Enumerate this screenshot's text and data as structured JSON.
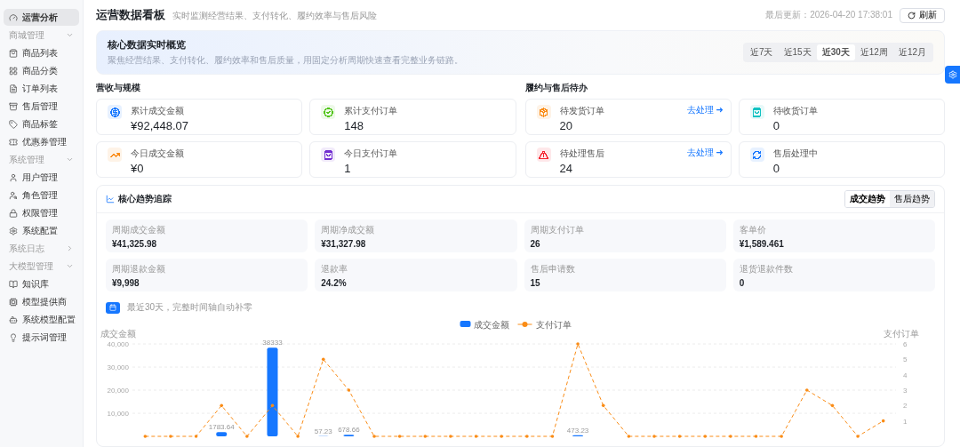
{
  "sidebar": {
    "items": [
      {
        "kind": "link",
        "label": "运营分析",
        "selected": true
      },
      {
        "kind": "group",
        "label": "商城管理",
        "expanded": true,
        "children": [
          {
            "label": "商品列表",
            "selected": false
          },
          {
            "label": "商品分类",
            "selected": false
          },
          {
            "label": "订单列表",
            "selected": false
          },
          {
            "label": "售后管理",
            "selected": false
          },
          {
            "label": "商品标签",
            "selected": false
          },
          {
            "label": "优惠券管理",
            "selected": false
          }
        ]
      },
      {
        "kind": "group",
        "label": "系统管理",
        "expanded": true,
        "children": [
          {
            "label": "用户管理",
            "selected": false
          },
          {
            "label": "角色管理",
            "selected": false
          },
          {
            "label": "权限管理",
            "selected": false
          },
          {
            "label": "系统配置",
            "selected": false
          }
        ]
      },
      {
        "kind": "group",
        "label": "系统日志",
        "expanded": false
      },
      {
        "kind": "group",
        "label": "大模型管理",
        "expanded": true,
        "children": [
          {
            "label": "知识库",
            "selected": false
          },
          {
            "label": "模型提供商",
            "selected": false
          },
          {
            "label": "系统模型配置",
            "selected": false
          },
          {
            "label": "提示词管理",
            "selected": false
          }
        ]
      }
    ]
  },
  "header": {
    "title": "运营数据看板",
    "subtitle": "实时监测经营结果、支付转化、履约效率与售后风险",
    "updated": "最后更新：2026-04-20 17:38:01",
    "refresh": "刷新"
  },
  "banner": {
    "title": "核心数据实时概览",
    "description": "聚焦经营结果、支付转化、履约效率和售后质量，用固定分析周期快速查看完整业务链路。",
    "periods": [
      {
        "label": "近7天",
        "selected": false
      },
      {
        "label": "近15天",
        "selected": false
      },
      {
        "label": "近30天",
        "selected": true
      },
      {
        "label": "近12周",
        "selected": false
      },
      {
        "label": "近12月",
        "selected": false
      }
    ]
  },
  "sections": [
    {
      "title": "营收与规模",
      "cards": [
        {
          "label": "累计成交金额",
          "value": "¥92,448.07",
          "color": "#1677ff"
        },
        {
          "label": "累计支付订单",
          "value": "148",
          "color": "#52c41a"
        },
        {
          "label": "今日成交金额",
          "value": "¥0",
          "color": "#fa8c16"
        },
        {
          "label": "今日支付订单",
          "value": "1",
          "color": "#722ed1"
        }
      ]
    },
    {
      "title": "履约与售后待办",
      "cards": [
        {
          "label": "待发货订单",
          "value": "20",
          "color": "#fa8c16",
          "action": "去处理 ➜"
        },
        {
          "label": "待收货订单",
          "value": "0",
          "color": "#13c2c2"
        },
        {
          "label": "待处理售后",
          "value": "24",
          "color": "#f5222d",
          "action": "去处理 ➜"
        },
        {
          "label": "售后处理中",
          "value": "0",
          "color": "#1677ff"
        }
      ]
    }
  ],
  "trend": {
    "title": "核心趋势追踪",
    "toggles": [
      {
        "label": "成交趋势",
        "selected": true
      },
      {
        "label": "售后趋势",
        "selected": false
      }
    ],
    "metrics": [
      {
        "label": "周期成交金额",
        "value": "¥41,325.98"
      },
      {
        "label": "周期净成交额",
        "value": "¥31,327.98"
      },
      {
        "label": "周期支付订单",
        "value": "26"
      },
      {
        "label": "客单价",
        "value": "¥1,589.461"
      },
      {
        "label": "周期退款金额",
        "value": "¥9,998"
      },
      {
        "label": "退款率",
        "value": "24.2%"
      },
      {
        "label": "售后申请数",
        "value": "15"
      },
      {
        "label": "退货退款件数",
        "value": "0"
      }
    ],
    "range_note": "最近30天，完整时间轴自动补零",
    "chart_data": {
      "type": "bar",
      "ylabel": "成交金额",
      "y2label": "支付订单",
      "ylim": [
        0,
        40000
      ],
      "yticks": [
        {
          "value": 10000,
          "label": "10,000"
        },
        {
          "value": 20000,
          "label": "20,000"
        },
        {
          "value": 30000,
          "label": "30,000"
        },
        {
          "value": 40000,
          "label": "40,000"
        }
      ],
      "y2lim": [
        0,
        6
      ],
      "y2ticks": [
        1,
        2,
        3,
        4,
        5,
        6
      ],
      "grid": true,
      "legend": "top",
      "series": [
        {
          "name": "成交金额",
          "type": "bar",
          "value_labels": [
            null,
            null,
            null,
            "1783.64",
            null,
            "38333",
            null,
            "57.23",
            "678.66",
            null,
            null,
            null,
            null,
            null,
            null,
            null,
            null,
            "473.23",
            null,
            null,
            null,
            null,
            null,
            null,
            null,
            null,
            null,
            null,
            null,
            null
          ],
          "color": "#1677ff",
          "values": [
            0,
            0,
            0,
            1783.64,
            0,
            38333,
            0,
            57.23,
            678.66,
            0,
            0,
            0,
            0,
            0,
            0,
            0,
            0,
            473.23,
            0,
            0,
            0,
            0,
            0,
            0,
            0,
            0,
            0,
            0,
            0,
            0
          ]
        },
        {
          "name": "支付订单",
          "type": "line",
          "axis": "y2",
          "line_style": "dashed",
          "color": "#fa8c16",
          "values": [
            0,
            0,
            0,
            2,
            0,
            2,
            0,
            5,
            3,
            0,
            0,
            0,
            0,
            0,
            0,
            0,
            0,
            6,
            2,
            0,
            0,
            0,
            0,
            0,
            0,
            0,
            3,
            2,
            0,
            1
          ]
        }
      ]
    }
  }
}
